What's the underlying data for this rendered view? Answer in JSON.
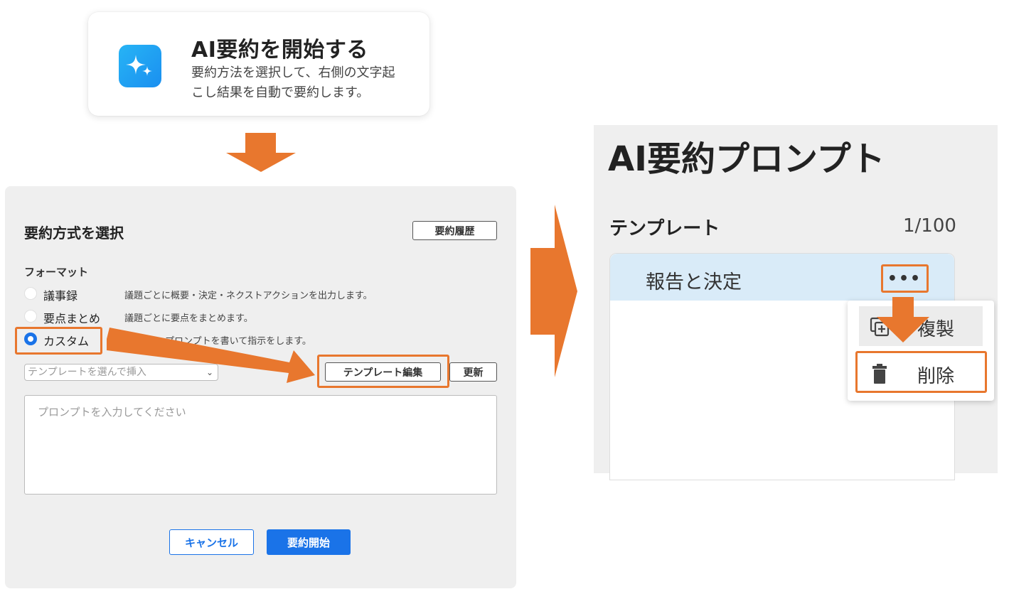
{
  "start_card": {
    "title": "AI要約を開始する",
    "description": "要約方法を選択して、右側の文字起こし結果を自動で要約します。",
    "icon": "sparkle-icon"
  },
  "dialog": {
    "title": "要約方式を選択",
    "history_button": "要約履歴",
    "format_label": "フォーマット",
    "options": [
      {
        "label": "議事録",
        "description": "議題ごとに概要・決定・ネクストアクションを出力します。",
        "checked": false
      },
      {
        "label": "要点まとめ",
        "description": "議題ごとに要点をまとめます。",
        "checked": false
      },
      {
        "label": "カスタム",
        "description": "プロンプトを書いて指示をします。",
        "checked": true
      }
    ],
    "template_select_placeholder": "テンプレートを選んで挿入",
    "template_edit_button": "テンプレート編集",
    "update_button": "更新",
    "prompt_placeholder": "プロンプトを入力してください",
    "cancel_button": "キャンセル",
    "start_button": "要約開始"
  },
  "prompt_panel": {
    "title": "AI要約プロンプト",
    "template_label": "テンプレート",
    "template_count": "1/100",
    "templates": [
      {
        "name": "報告と決定"
      }
    ],
    "more_button": "•••",
    "menu": [
      {
        "label": "複製",
        "icon": "duplicate-icon"
      },
      {
        "label": "削除",
        "icon": "trash-icon"
      }
    ]
  },
  "colors": {
    "accent_blue": "#1a73e8",
    "highlight_orange": "#e8772e",
    "selected_row": "#d9ebf8"
  }
}
